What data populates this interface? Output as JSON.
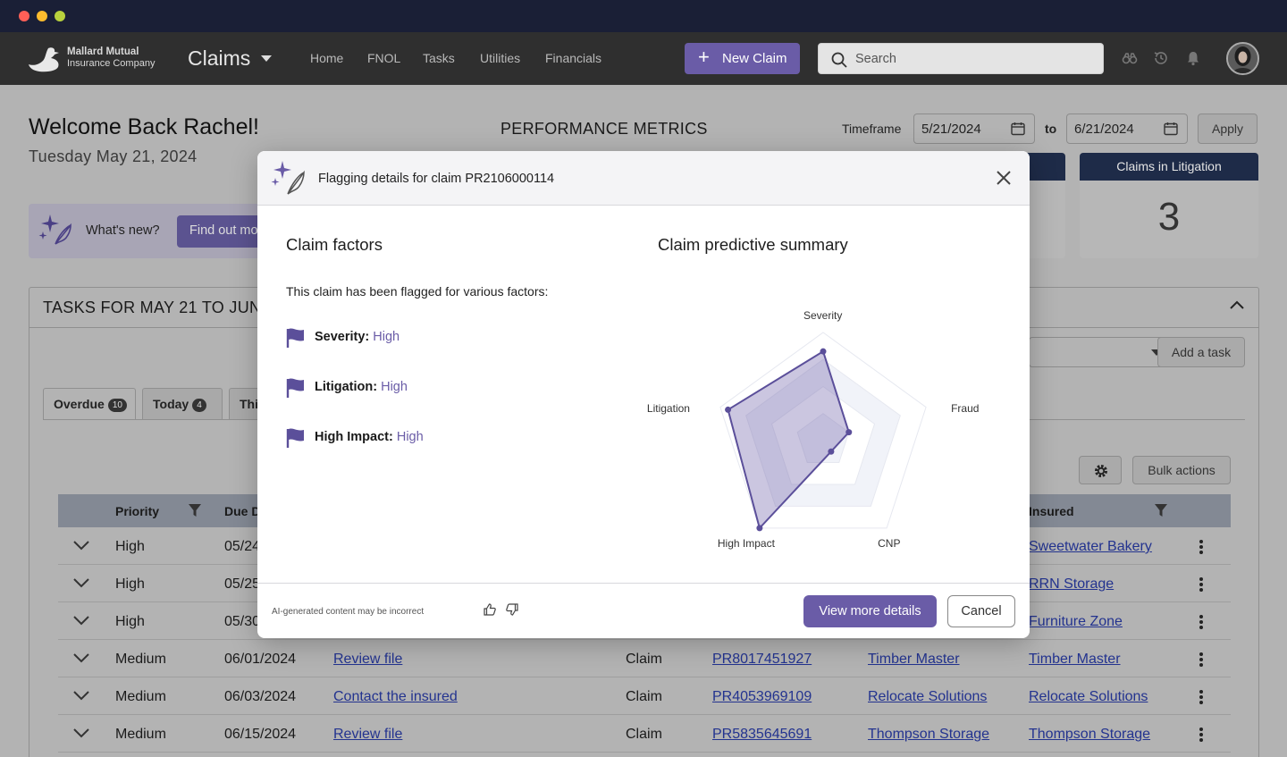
{
  "window": {
    "controls": [
      "close",
      "minimize",
      "maximize"
    ]
  },
  "nav": {
    "logo_line1": "Mallard Mutual",
    "logo_line2": "Insurance Company",
    "app_title": "Claims",
    "links": [
      "Home",
      "FNOL",
      "Tasks",
      "Utilities",
      "Financials"
    ],
    "new_claim_label": "New Claim",
    "search_placeholder": "Search",
    "icons": [
      "binoculars-icon",
      "history-icon",
      "bell-icon"
    ]
  },
  "dashboard": {
    "welcome": "Welcome Back Rachel!",
    "date": "Tuesday May 21, 2024",
    "performance_title": "PERFORMANCE METRICS",
    "timeframe_label": "Timeframe",
    "date_from": "5/21/2024",
    "to_label": "to",
    "date_to": "6/21/2024",
    "apply_label": "Apply",
    "metric_cards": [
      {
        "title": "",
        "value": ""
      },
      {
        "title": "Claims in Litigation",
        "value": "3"
      }
    ],
    "whats_new_label": "What's new?",
    "find_out_label": "Find out mo"
  },
  "tasks": {
    "title": "TASKS FOR MAY 21 TO JUNE",
    "add_task_label": "Add a task",
    "bulk_actions_label": "Bulk actions",
    "tabs": [
      {
        "label": "Overdue",
        "count": "10"
      },
      {
        "label": "Today",
        "count": "4"
      },
      {
        "label": "Thi",
        "count": ""
      }
    ],
    "columns": [
      "Priority",
      "Due D",
      "Insured"
    ],
    "rows": [
      {
        "priority": "High",
        "due": "05/24",
        "task": "",
        "type": "",
        "claim": "",
        "account": "",
        "insured": "Sweetwater Bakery"
      },
      {
        "priority": "High",
        "due": "05/25",
        "task": "",
        "type": "",
        "claim": "",
        "account": "",
        "insured": "RRN Storage"
      },
      {
        "priority": "High",
        "due": "05/30",
        "task": "",
        "type": "",
        "claim": "",
        "account": "",
        "insured": "Furniture Zone"
      },
      {
        "priority": "Medium",
        "due": "06/01/2024",
        "task": "Review file",
        "type": "Claim",
        "claim": "PR8017451927",
        "account": "Timber Master",
        "insured": "Timber Master"
      },
      {
        "priority": "Medium",
        "due": "06/03/2024",
        "task": "Contact the insured",
        "type": "Claim",
        "claim": "PR4053969109",
        "account": "Relocate Solutions",
        "insured": "Relocate Solutions"
      },
      {
        "priority": "Medium",
        "due": "06/15/2024",
        "task": "Review file",
        "type": "Claim",
        "claim": "PR5835645691",
        "account": "Thompson Storage",
        "insured": "Thompson Storage"
      }
    ]
  },
  "modal": {
    "title": "Flagging details for claim PR2106000114",
    "factors_title": "Claim factors",
    "intro": "This claim has been flagged for various factors:",
    "factors": [
      {
        "label": "Severity:",
        "value": "High"
      },
      {
        "label": "Litigation:",
        "value": "High"
      },
      {
        "label": "High Impact:",
        "value": "High"
      }
    ],
    "summary_title": "Claim predictive summary",
    "ai_note": "AI-generated content may be incorrect",
    "view_more_label": "View more details",
    "cancel_label": "Cancel",
    "accent_color": "#6a5ca7"
  },
  "chart_data": {
    "type": "radar",
    "axes": [
      "Severity",
      "Fraud",
      "CNP",
      "High Impact",
      "Litigation"
    ],
    "scale_max": 4,
    "values": [
      3.3,
      1.0,
      0.5,
      4.0,
      3.7
    ]
  }
}
